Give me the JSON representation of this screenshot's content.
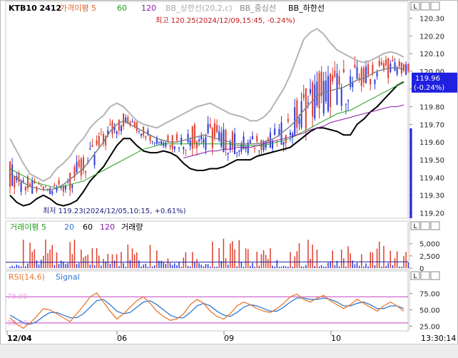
{
  "theme": {
    "up": "#e03c2c",
    "down": "#2c3cd8",
    "ma5": "#e06030",
    "ma60": "#20a020",
    "ma120": "#8a1aa8",
    "bbUpper": "#b4b4b4",
    "bbMid": "#808080",
    "bbLower": "#000000",
    "rsi": "#e87830",
    "signal": "#3078d0",
    "rsiBand": "#c040c0",
    "priceTag": "#2020e0"
  },
  "legend": {
    "title": "KTB10 2412",
    "ma_prefix": "가격이평",
    "ma_periods": [
      "5",
      "60",
      "120"
    ],
    "bb_upper": "BB_상한선(20,2,c)",
    "bb_mid": "BB_중심선",
    "bb_lower": "BB_하한선"
  },
  "annotations": {
    "high": "최고 120.25(2024/12/09,15:45, -0.24%)",
    "low": "최저 119.23(2024/12/05,10:15, +0.61%)"
  },
  "price_tag": {
    "value": "119.96",
    "change": "(-0.24%)"
  },
  "volume_legend": {
    "ma_prefix": "거래이평",
    "periods": [
      "5",
      "20",
      "60",
      "120"
    ],
    "volume_label": "거래량"
  },
  "rsi_legend": {
    "rsi": "RSI(14,6)",
    "signal": "Signal"
  },
  "rsi_levels": {
    "upper_label": "70.00",
    "lower_label": "30.00"
  },
  "x_axis": {
    "labels": [
      "12/04",
      "06",
      "09",
      "10"
    ],
    "time": "13:30:14"
  },
  "toolbar": {
    "l1": "L",
    "off": "off",
    "icons": [
      "scroll-start-icon",
      "pause-icon",
      "scroll-end-icon",
      "zoom-slider-icon",
      "zoom-out-icon",
      "zoom-in-icon",
      "crosshair-icon",
      "settings-icon",
      "line-draw-icon",
      "cursor-icon",
      "expand-icon",
      "arrow-left-icon",
      "arrow-right-icon",
      "shrink-icon",
      "text-icon",
      "chart-icon",
      "period-icon"
    ]
  },
  "panel_buttons": [
    "L",
    "L",
    "L"
  ],
  "chart_data": [
    {
      "type": "candlestick",
      "title": "KTB10 2412",
      "ylim": [
        119.17,
        120.33
      ],
      "yticks": [
        "120.30",
        "120.20",
        "120.10",
        "120.00",
        "119.90",
        "119.80",
        "119.70",
        "119.60",
        "119.50",
        "119.40",
        "119.30",
        "119.20"
      ],
      "x_labels": [
        "12/04",
        "06",
        "09",
        "10"
      ],
      "last_price": 119.96,
      "last_change_pct": -0.24,
      "high": {
        "value": 120.25,
        "time": "2024/12/09,15:45",
        "change_pct": -0.24
      },
      "low": {
        "value": 119.23,
        "time": "2024/12/05,10:15",
        "change_pct": 0.61
      },
      "series": [
        {
          "name": "BB_상한선",
          "values": [
            119.62,
            119.55,
            119.48,
            119.42,
            119.4,
            119.38,
            119.4,
            119.45,
            119.48,
            119.52,
            119.58,
            119.62,
            119.68,
            119.72,
            119.75,
            119.8,
            119.82,
            119.8,
            119.76,
            119.72,
            119.7,
            119.69,
            119.68,
            119.7,
            119.72,
            119.74,
            119.76,
            119.78,
            119.8,
            119.81,
            119.82,
            119.8,
            119.78,
            119.76,
            119.75,
            119.74,
            119.72,
            119.72,
            119.74,
            119.78,
            119.84,
            119.9,
            119.98,
            120.08,
            120.18,
            120.22,
            120.24,
            120.21,
            120.16,
            120.12,
            120.1,
            120.08,
            120.06,
            120.05,
            120.06,
            120.08,
            120.1,
            120.11,
            120.1,
            120.08
          ]
        },
        {
          "name": "BB_중심선",
          "values": [
            119.42,
            119.4,
            119.37,
            119.35,
            119.34,
            119.33,
            119.33,
            119.34,
            119.36,
            119.39,
            119.42,
            119.45,
            119.5,
            119.55,
            119.6,
            119.66,
            119.7,
            119.72,
            119.7,
            119.68,
            119.66,
            119.64,
            119.62,
            119.61,
            119.6,
            119.6,
            119.61,
            119.62,
            119.63,
            119.64,
            119.63,
            119.62,
            119.61,
            119.6,
            119.59,
            119.59,
            119.59,
            119.59,
            119.6,
            119.61,
            119.63,
            119.66,
            119.69,
            119.73,
            119.78,
            119.82,
            119.86,
            119.88,
            119.89,
            119.9,
            119.91,
            119.93,
            119.95,
            119.96,
            119.98,
            120.0,
            120.01,
            120.02,
            120.02,
            120.01
          ]
        },
        {
          "name": "BB_하한선",
          "values": [
            119.3,
            119.26,
            119.24,
            119.25,
            119.28,
            119.3,
            119.28,
            119.25,
            119.24,
            119.25,
            119.27,
            119.32,
            119.38,
            119.42,
            119.46,
            119.52,
            119.58,
            119.62,
            119.62,
            119.58,
            119.55,
            119.54,
            119.54,
            119.55,
            119.54,
            119.52,
            119.48,
            119.45,
            119.44,
            119.44,
            119.45,
            119.45,
            119.46,
            119.48,
            119.5,
            119.5,
            119.5,
            119.52,
            119.53,
            119.54,
            119.55,
            119.56,
            119.57,
            119.6,
            119.63,
            119.66,
            119.68,
            119.68,
            119.67,
            119.66,
            119.64,
            119.64,
            119.7,
            119.73,
            119.77,
            119.8,
            119.84,
            119.88,
            119.92,
            119.94
          ]
        },
        {
          "name": "가격이평 60",
          "values": [
            119.45,
            119.43,
            119.41,
            119.39,
            119.37,
            119.36,
            119.35,
            119.34,
            119.35,
            119.36,
            119.37,
            119.38,
            119.4,
            119.42,
            119.44,
            119.46,
            119.48,
            119.5,
            119.52,
            119.54,
            119.56,
            119.57,
            119.58,
            119.59,
            119.59,
            119.59,
            119.59,
            119.59,
            119.59,
            119.59,
            119.59,
            119.59,
            119.59,
            119.59,
            119.58,
            119.58,
            119.58,
            119.58,
            119.58,
            119.59,
            119.6,
            119.61,
            119.62,
            119.64,
            119.66,
            119.68,
            119.7,
            119.72,
            119.74,
            119.76,
            119.77,
            119.78,
            119.8,
            119.82,
            119.84,
            119.86,
            119.88,
            119.9,
            119.92,
            119.94
          ]
        },
        {
          "name": "가격이평 120",
          "values": [
            null,
            null,
            null,
            null,
            null,
            null,
            null,
            null,
            null,
            null,
            null,
            null,
            null,
            null,
            null,
            null,
            null,
            null,
            null,
            null,
            null,
            null,
            null,
            null,
            null,
            null,
            119.51,
            119.52,
            119.53,
            119.54,
            119.55,
            119.55,
            119.56,
            119.56,
            119.57,
            119.57,
            119.57,
            119.58,
            119.59,
            119.6,
            119.61,
            119.62,
            119.63,
            119.64,
            119.65,
            119.67,
            119.68,
            119.69,
            119.71,
            119.72,
            119.73,
            119.74,
            119.75,
            119.76,
            119.77,
            119.78,
            119.79,
            119.8,
            119.8,
            119.81
          ]
        }
      ]
    },
    {
      "type": "bar",
      "title": "거래량",
      "ylim": [
        0,
        7000
      ],
      "yticks": [
        "5,000",
        "2,500",
        "0"
      ]
    },
    {
      "type": "line",
      "title": "RSI(14,6)",
      "ylim": [
        20,
        92
      ],
      "yticks": [
        "75.00",
        "50.00",
        "25.00"
      ],
      "levels": [
        70,
        30
      ],
      "series": [
        {
          "name": "RSI(14,6)",
          "values": [
            38,
            28,
            22,
            30,
            40,
            52,
            50,
            44,
            38,
            32,
            44,
            56,
            70,
            76,
            62,
            48,
            36,
            44,
            54,
            64,
            70,
            60,
            48,
            40,
            34,
            36,
            44,
            58,
            66,
            60,
            48,
            40,
            36,
            44,
            56,
            62,
            58,
            52,
            48,
            46,
            52,
            60,
            70,
            74,
            66,
            62,
            68,
            72,
            64,
            58,
            52,
            58,
            66,
            60,
            54,
            48,
            56,
            62,
            56,
            48
          ]
        },
        {
          "name": "Signal",
          "values": [
            42,
            36,
            30,
            28,
            32,
            40,
            46,
            46,
            42,
            38,
            38,
            44,
            54,
            64,
            66,
            58,
            48,
            44,
            46,
            54,
            62,
            64,
            58,
            50,
            42,
            38,
            38,
            46,
            56,
            60,
            56,
            48,
            42,
            40,
            46,
            54,
            58,
            56,
            52,
            48,
            48,
            54,
            62,
            68,
            68,
            66,
            66,
            68,
            66,
            62,
            56,
            56,
            60,
            62,
            58,
            52,
            52,
            56,
            56,
            52
          ]
        }
      ]
    }
  ]
}
